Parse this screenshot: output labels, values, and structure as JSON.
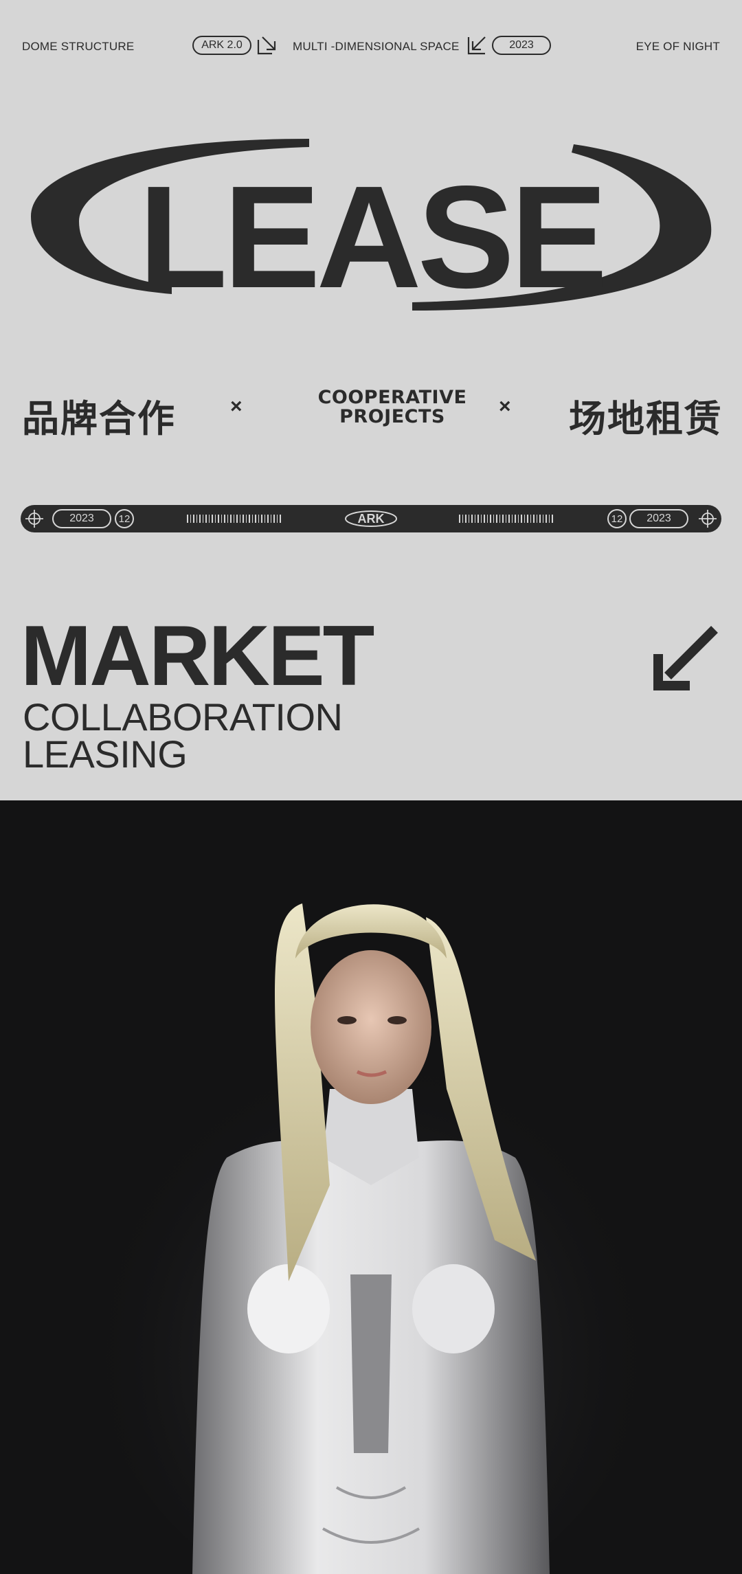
{
  "header": {
    "left_text": "DOME STRUCTURE",
    "pill_left": "ARK 2.0",
    "middle_text": "MULTI -DIMENSIONAL SPACE",
    "pill_right": "2023",
    "right_text": "EYE OF NIGHT"
  },
  "hero": {
    "title": "LEASE"
  },
  "bands": {
    "cn_left": "品牌合作",
    "times": "×",
    "en_line1": "COOPERATIVE",
    "en_line2": "PROJECTS",
    "cn_right": "场地租赁"
  },
  "strip": {
    "year": "2023",
    "number": "12",
    "logo": "ARK"
  },
  "market": {
    "title": "MARKET",
    "line1": "COLLABORATION",
    "line2": "LEASING"
  },
  "icons": [
    "arrow-down-right-icon",
    "arrow-down-left-icon",
    "crosshair-icon",
    "big-arrow-down-left-icon"
  ],
  "colors": {
    "background": "#d6d6d6",
    "ink": "#2b2b2b",
    "photo_bg": "#131314"
  }
}
